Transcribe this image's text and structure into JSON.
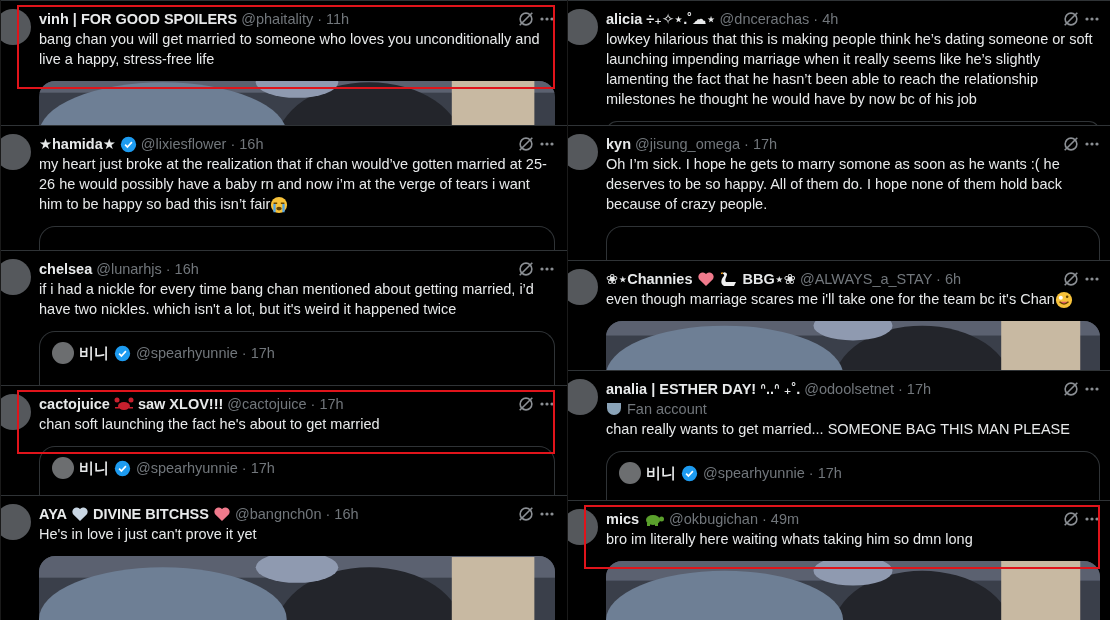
{
  "columns": [
    {
      "tweets": [
        {
          "name_parts": [
            {
              "kind": "text",
              "text": "vinh | FOR GOOD SPOILERS"
            }
          ],
          "verified": false,
          "meta": "@phaitality · 11h",
          "body_parts": [
            {
              "kind": "text",
              "text": "bang chan you will get married to someone who loves you unconditionally and live a happy, stress-free life"
            }
          ],
          "media": {
            "kind": "picture"
          },
          "highlighted": true
        },
        {
          "name_parts": [
            {
              "kind": "text",
              "text": "★hamida★"
            }
          ],
          "verified": true,
          "meta": "@lixiesflower · 16h",
          "body_parts": [
            {
              "kind": "text",
              "text": "my heart just broke at the realization that if chan would’ve gotten married at 25-26 he would possibly have a baby rn and now i’m at the verge of tears i want him to be happy so bad this isn’t fair"
            },
            {
              "kind": "sob"
            }
          ],
          "media": {
            "kind": "quote"
          },
          "highlighted": false
        },
        {
          "name_parts": [
            {
              "kind": "text",
              "text": "chelsea"
            }
          ],
          "verified": false,
          "meta": "@lunarhjs · 16h",
          "body_parts": [
            {
              "kind": "text",
              "text": "if i had a nickle for every time bang chan mentioned about getting married, i’d have two nickles. which isn't a lot, but it's weird it happened twice"
            }
          ],
          "media": {
            "kind": "quote",
            "author": "비니",
            "verified": true,
            "meta": "@spearhyunnie · 17h"
          },
          "highlighted": false
        },
        {
          "name_parts": [
            {
              "kind": "text",
              "text": "cactojuice"
            },
            {
              "kind": "crab"
            },
            {
              "kind": "text",
              "text": "saw XLOV!!!"
            }
          ],
          "verified": false,
          "meta": "@cactojuice · 17h",
          "body_parts": [
            {
              "kind": "text",
              "text": "chan soft launching the fact he's about to get married"
            }
          ],
          "media": {
            "kind": "quote",
            "author": "비니",
            "verified": true,
            "meta": "@spearhyunnie · 17h"
          },
          "highlighted": true
        },
        {
          "name_parts": [
            {
              "kind": "text",
              "text": "AYA"
            },
            {
              "kind": "heart",
              "color": "#c9d6e3"
            },
            {
              "kind": "text",
              "text": "DIVINE BITCHSS"
            },
            {
              "kind": "heart",
              "color": "#f07a8c"
            }
          ],
          "verified": false,
          "meta": "@bangnch0n · 16h",
          "body_parts": [
            {
              "kind": "text",
              "text": "He's in love i just can't prove it yet"
            }
          ],
          "media": {
            "kind": "picture"
          },
          "highlighted": false
        }
      ]
    },
    {
      "tweets": [
        {
          "name_parts": [
            {
              "kind": "text",
              "text": "alicia ÷₊✧⋆.˚☁⋆"
            }
          ],
          "verified": false,
          "meta": "@dncerachas · 4h",
          "body_parts": [
            {
              "kind": "text",
              "text": "lowkey hilarious that this is making people think he’s dating someone or soft launching impending marriage when it really seems like he’s slightly lamenting the fact that he hasn’t been able to reach the relationship milestones he thought he would have by now bc of his job"
            }
          ],
          "media": {
            "kind": "quote"
          },
          "highlighted": false
        },
        {
          "name_parts": [
            {
              "kind": "text",
              "text": "kyn"
            }
          ],
          "verified": false,
          "meta": "@jisung_omega · 17h",
          "body_parts": [
            {
              "kind": "text",
              "text": "Oh I’m sick. I hope he gets to marry somone as soon as he wants :( he deserves to be so happy. All of them do. I hope none of them hold back because of crazy people."
            }
          ],
          "media": {
            "kind": "quote"
          },
          "highlighted": false
        },
        {
          "name_parts": [
            {
              "kind": "text",
              "text": "❀⋆Channies"
            },
            {
              "kind": "heart",
              "color": "#f07a8c"
            },
            {
              "kind": "swan"
            },
            {
              "kind": "text",
              "text": "BBG⋆❀"
            }
          ],
          "verified": false,
          "meta": "@ALWAYS_a_STAY · 6h",
          "body_parts": [
            {
              "kind": "text",
              "text": "even though marriage scares me i'll take one for the team bc it's Chan"
            },
            {
              "kind": "zany"
            }
          ],
          "media": {
            "kind": "picture"
          },
          "highlighted": false
        },
        {
          "name_parts": [
            {
              "kind": "text",
              "text": "analia | ESTHER DAY! ᐢ..ᐢ ₊˚."
            }
          ],
          "verified": false,
          "meta": "@odoolsetnet · 17h",
          "label": "Fan account",
          "body_parts": [
            {
              "kind": "text",
              "text": "chan really wants to get married... SOMEONE BAG THIS MAN PLEASE"
            }
          ],
          "media": {
            "kind": "quote",
            "author": "비니",
            "verified": true,
            "meta": "@spearhyunnie · 17h"
          },
          "highlighted": false
        },
        {
          "name_parts": [
            {
              "kind": "text",
              "text": "mics"
            },
            {
              "kind": "turtle"
            }
          ],
          "verified": false,
          "meta": "@okbugichan · 49m",
          "body_parts": [
            {
              "kind": "text",
              "text": "bro im literally here waiting whats taking him so dmn long"
            }
          ],
          "media": {
            "kind": "picture"
          },
          "highlighted": true
        }
      ]
    }
  ]
}
